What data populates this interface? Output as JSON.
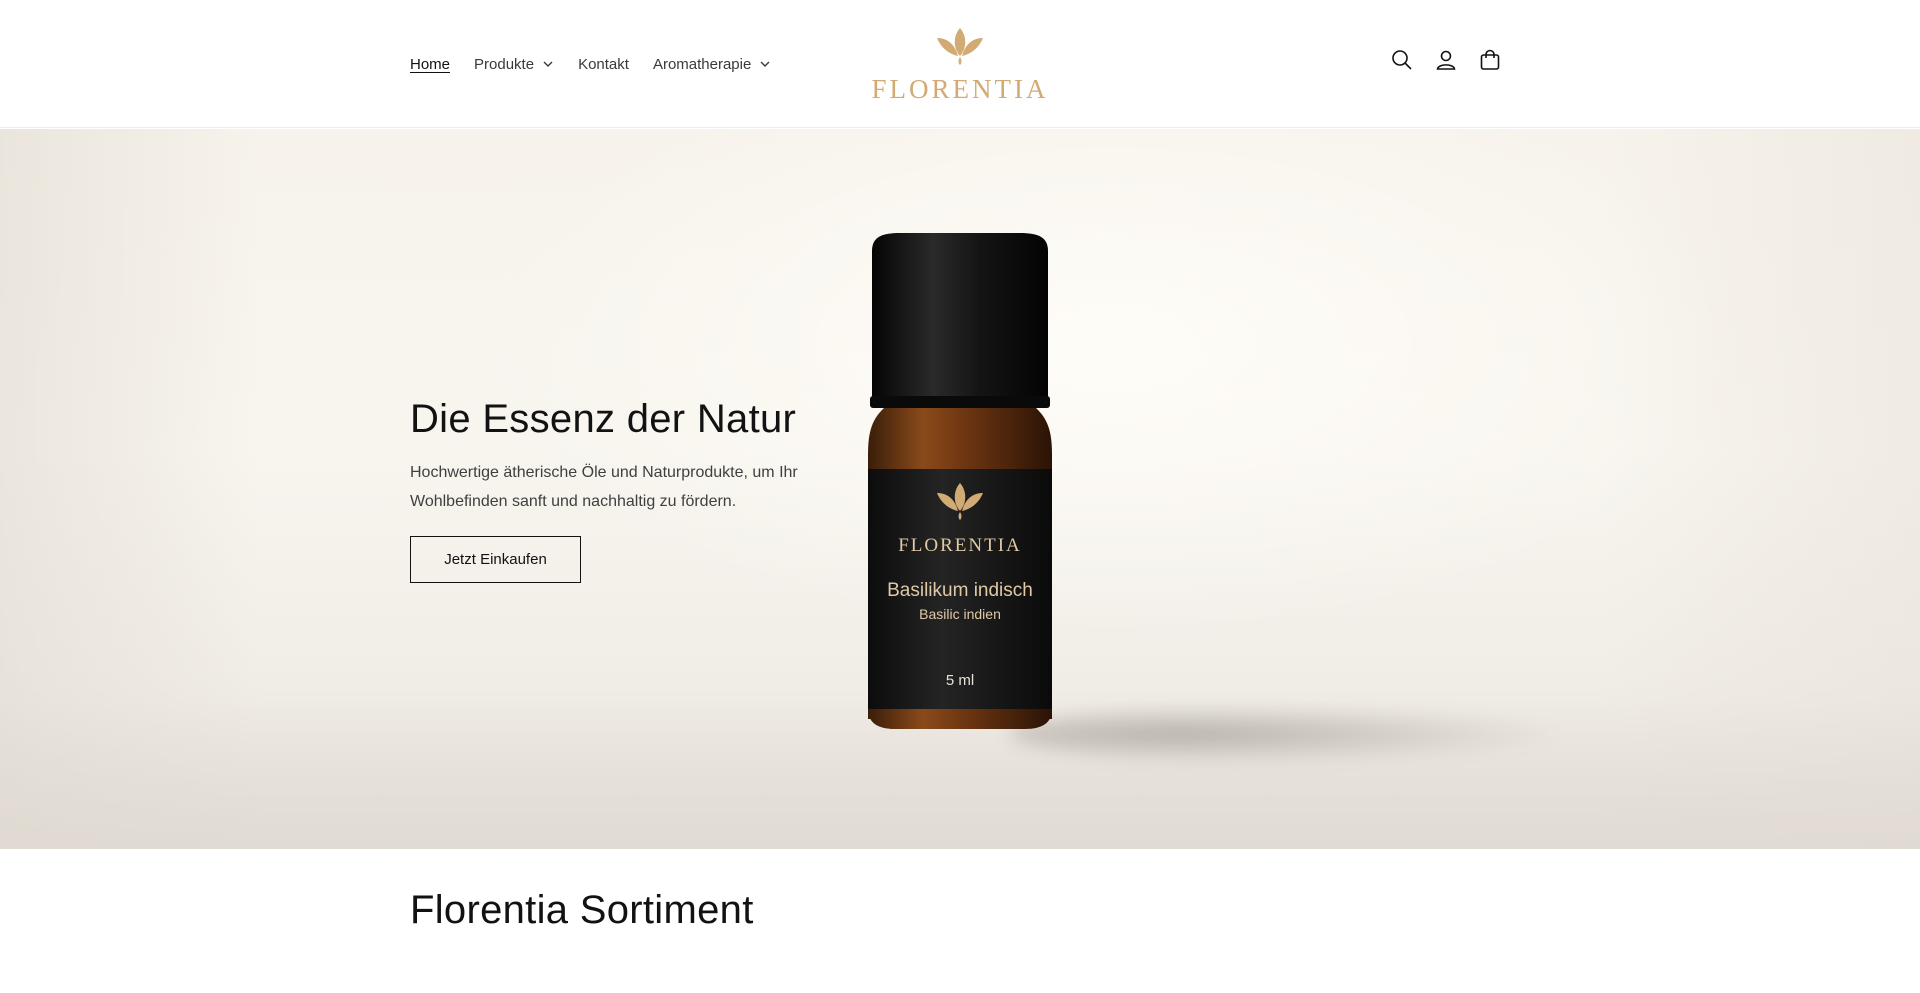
{
  "header": {
    "nav": [
      {
        "label": "Home",
        "active": true,
        "has_dropdown": false
      },
      {
        "label": "Produkte",
        "active": false,
        "has_dropdown": true
      },
      {
        "label": "Kontakt",
        "active": false,
        "has_dropdown": false
      },
      {
        "label": "Aromatherapie",
        "active": false,
        "has_dropdown": true
      }
    ],
    "logo_text": "FLORENTIA",
    "icons": [
      "search-icon",
      "account-icon",
      "cart-icon"
    ]
  },
  "hero": {
    "title": "Die Essenz der Natur",
    "text": "Hochwertige ätherische Öle und Naturprodukte, um Ihr Wohlbefinden sanft und nachhaltig zu fördern.",
    "button_label": "Jetzt Einkaufen",
    "product": {
      "brand": "FLORENTIA",
      "name": "Basilikum indisch",
      "subname": "Basilic indien",
      "volume": "5 ml"
    }
  },
  "section": {
    "title": "Florentia Sortiment"
  },
  "colors": {
    "brand_gold": "#d2aa73",
    "text": "#121212",
    "hero_bg": "#f7f3ec"
  }
}
